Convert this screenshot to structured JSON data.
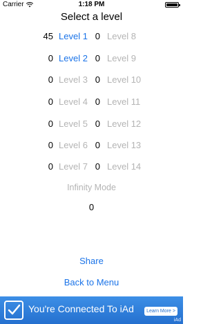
{
  "status_bar": {
    "carrier": "Carrier",
    "time": "1:18 PM"
  },
  "title": "Select a level",
  "levels": [
    {
      "left_score": "45",
      "left_label": "Level 1",
      "right_score": "0",
      "right_label": "Level 8"
    },
    {
      "left_score": "0",
      "left_label": "Level 2",
      "right_score": "0",
      "right_label": "Level 9"
    },
    {
      "left_score": "0",
      "left_label": "Level 3",
      "right_score": "0",
      "right_label": "Level 10"
    },
    {
      "left_score": "0",
      "left_label": "Level 4",
      "right_score": "0",
      "right_label": "Level 11"
    },
    {
      "left_score": "0",
      "left_label": "Level 5",
      "right_score": "0",
      "right_label": "Level 12"
    },
    {
      "left_score": "0",
      "left_label": "Level 6",
      "right_score": "0",
      "right_label": "Level 13"
    },
    {
      "left_score": "0",
      "left_label": "Level 7",
      "right_score": "0",
      "right_label": "Level 14"
    }
  ],
  "infinity": {
    "label": "Infinity Mode",
    "score": "0"
  },
  "actions": {
    "share": "Share",
    "back": "Back to Menu"
  },
  "ad": {
    "text": "You're Connected To iAd",
    "learn_more": "Learn More >",
    "tag": "iAd"
  },
  "colors": {
    "accent": "#1a73e8",
    "disabled": "#b4b4b4",
    "ad_background": "#2f7fdc"
  }
}
